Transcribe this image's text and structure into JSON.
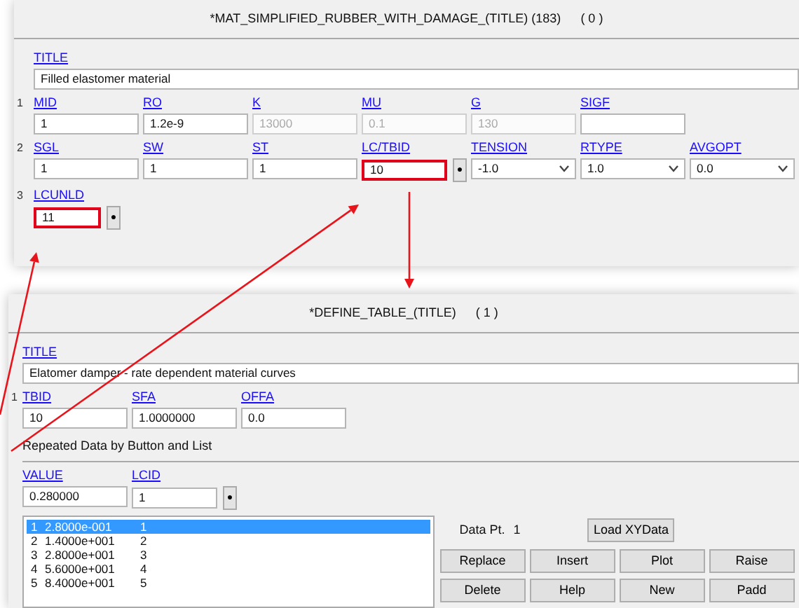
{
  "material_panel": {
    "title": "*MAT_SIMPLIFIED_RUBBER_WITH_DAMAGE_(TITLE) (183)",
    "count": "( 0 )",
    "title_label": "TITLE",
    "title_value": "Filled elastomer material",
    "rows": [
      {
        "number": "1",
        "fields": [
          {
            "label": "MID",
            "value": "1",
            "kind": "input",
            "disabled": false,
            "highlighted": false
          },
          {
            "label": "RO",
            "value": "1.2e-9",
            "kind": "input",
            "disabled": false,
            "highlighted": false
          },
          {
            "label": "K",
            "value": "13000",
            "kind": "input",
            "disabled": true,
            "highlighted": false
          },
          {
            "label": "MU",
            "value": "0.1",
            "kind": "input",
            "disabled": true,
            "highlighted": false
          },
          {
            "label": "G",
            "value": "130",
            "kind": "input",
            "disabled": true,
            "highlighted": false
          },
          {
            "label": "SIGF",
            "kind": "input",
            "disabled": false,
            "highlighted": false
          }
        ]
      },
      {
        "number": "2",
        "fields": [
          {
            "label": "SGL",
            "value": "1",
            "kind": "input",
            "disabled": false,
            "highlighted": false
          },
          {
            "label": "SW",
            "value": "1",
            "kind": "input",
            "disabled": false,
            "highlighted": false
          },
          {
            "label": "ST",
            "value": "1",
            "kind": "input",
            "disabled": false,
            "highlighted": false
          },
          {
            "label": "LC/TBID",
            "value": "10",
            "kind": "input",
            "disabled": false,
            "highlighted": true,
            "pick": "●"
          },
          {
            "label": "TENSION",
            "value": "-1.0",
            "kind": "select",
            "disabled": false,
            "highlighted": false
          },
          {
            "label": "RTYPE",
            "value": "1.0",
            "kind": "select",
            "disabled": false,
            "highlighted": false
          },
          {
            "label": "AVGOPT",
            "value": "0.0",
            "kind": "select",
            "disabled": false,
            "highlighted": false
          }
        ]
      },
      {
        "number": "3",
        "fields": [
          {
            "label": "LCUNLD",
            "value": "11",
            "kind": "input",
            "disabled": false,
            "highlighted": true,
            "pick": "●"
          }
        ]
      }
    ]
  },
  "table_panel": {
    "title": "*DEFINE_TABLE_(TITLE)",
    "count": "( 1 )",
    "title_label": "TITLE",
    "title_value": "Elatomer damper - rate dependent material curves",
    "rows": [
      {
        "number": "1",
        "fields": [
          {
            "label": "TBID",
            "value": "10",
            "kind": "input",
            "disabled": false,
            "highlighted": false
          },
          {
            "label": "SFA",
            "value": "1.0000000",
            "kind": "input",
            "disabled": false,
            "highlighted": false
          },
          {
            "label": "OFFA",
            "value": "0.0",
            "kind": "input",
            "disabled": false,
            "highlighted": false
          }
        ]
      }
    ],
    "section": "Repeated Data by Button and List",
    "repeat_fields": [
      {
        "label": "VALUE",
        "value": "0.280000",
        "kind": "input",
        "disabled": false,
        "highlighted": false
      },
      {
        "label": "LCID",
        "value": "1",
        "kind": "input",
        "disabled": false,
        "highlighted": false,
        "pick": "●"
      }
    ],
    "list": [
      {
        "index": "1",
        "value": "2.8000e-001",
        "lcid": "1",
        "selected": true
      },
      {
        "index": "2",
        "value": "1.4000e+001",
        "lcid": "2",
        "selected": false
      },
      {
        "index": "3",
        "value": "2.8000e+001",
        "lcid": "3",
        "selected": false
      },
      {
        "index": "4",
        "value": "5.6000e+001",
        "lcid": "4",
        "selected": false
      },
      {
        "index": "5",
        "value": "8.4000e+001",
        "lcid": "5",
        "selected": false
      }
    ],
    "data_pt_label": "Data Pt.",
    "data_pt_value": "1",
    "load_button": "Load XYData",
    "buttons": [
      "Replace",
      "Insert",
      "Plot",
      "Raise",
      "Delete",
      "Help",
      "New",
      "Padd"
    ]
  }
}
